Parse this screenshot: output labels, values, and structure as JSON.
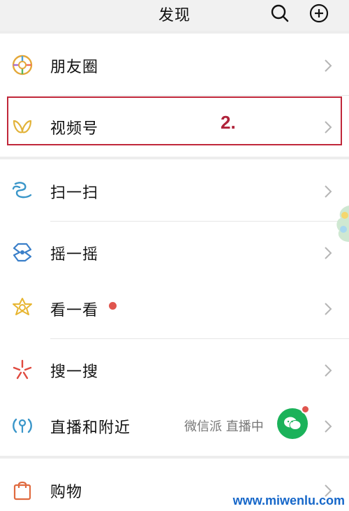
{
  "header": {
    "title": "发现"
  },
  "menu": {
    "moments": "朋友圈",
    "channels": "视频号",
    "scan": "扫一扫",
    "shake": "摇一摇",
    "top_stories": "看一看",
    "search": "搜一搜",
    "live_nearby": "直播和附近",
    "shopping": "购物"
  },
  "live": {
    "status": "微信派 直播中"
  },
  "annotation": {
    "label": "2."
  },
  "watermark": {
    "text": "www.miwenlu.com"
  },
  "colors": {
    "background": "#ededed",
    "card": "#ffffff",
    "accent_green": "#1bb25a",
    "badge_red": "#e0554e",
    "annotation_red": "#c0273a",
    "watermark_blue": "#1667c9"
  },
  "icons": {
    "header": [
      "search-icon",
      "add-icon"
    ],
    "rows": [
      "moments-icon",
      "channels-icon",
      "scan-icon",
      "shake-icon",
      "top-stories-icon",
      "search-feature-icon",
      "live-nearby-icon",
      "shopping-icon"
    ]
  }
}
